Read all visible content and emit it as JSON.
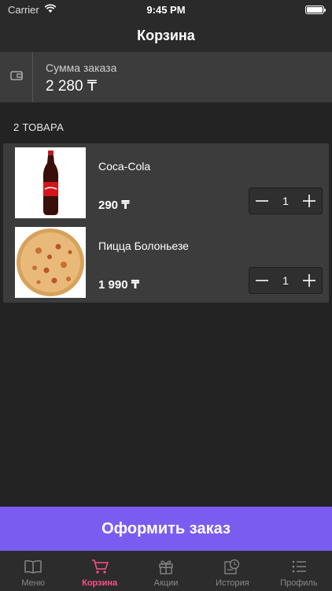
{
  "status_bar": {
    "carrier": "Carrier",
    "time": "9:45 PM"
  },
  "nav": {
    "title": "Корзина"
  },
  "summary": {
    "label": "Сумма заказа",
    "value": "2 280 ₸"
  },
  "cart": {
    "count_label": "2 ТОВАРА",
    "items": [
      {
        "name": "Coca-Cola",
        "price": "290 ₸",
        "quantity": "1"
      },
      {
        "name": "Пицца Болоньезе",
        "price": "1 990 ₸",
        "quantity": "1"
      }
    ]
  },
  "checkout": {
    "label": "Оформить заказ"
  },
  "tab_bar": {
    "items": [
      {
        "label": "Меню",
        "icon": "book-icon"
      },
      {
        "label": "Корзина",
        "icon": "cart-icon"
      },
      {
        "label": "Акции",
        "icon": "gift-icon"
      },
      {
        "label": "История",
        "icon": "history-icon"
      },
      {
        "label": "Профиль",
        "icon": "list-icon"
      }
    ],
    "active": "Корзина"
  },
  "colors": {
    "accent_button": "#7b5cf0",
    "active_tab": "#ff4f8a",
    "background": "#232323",
    "card": "#3c3c3c"
  }
}
